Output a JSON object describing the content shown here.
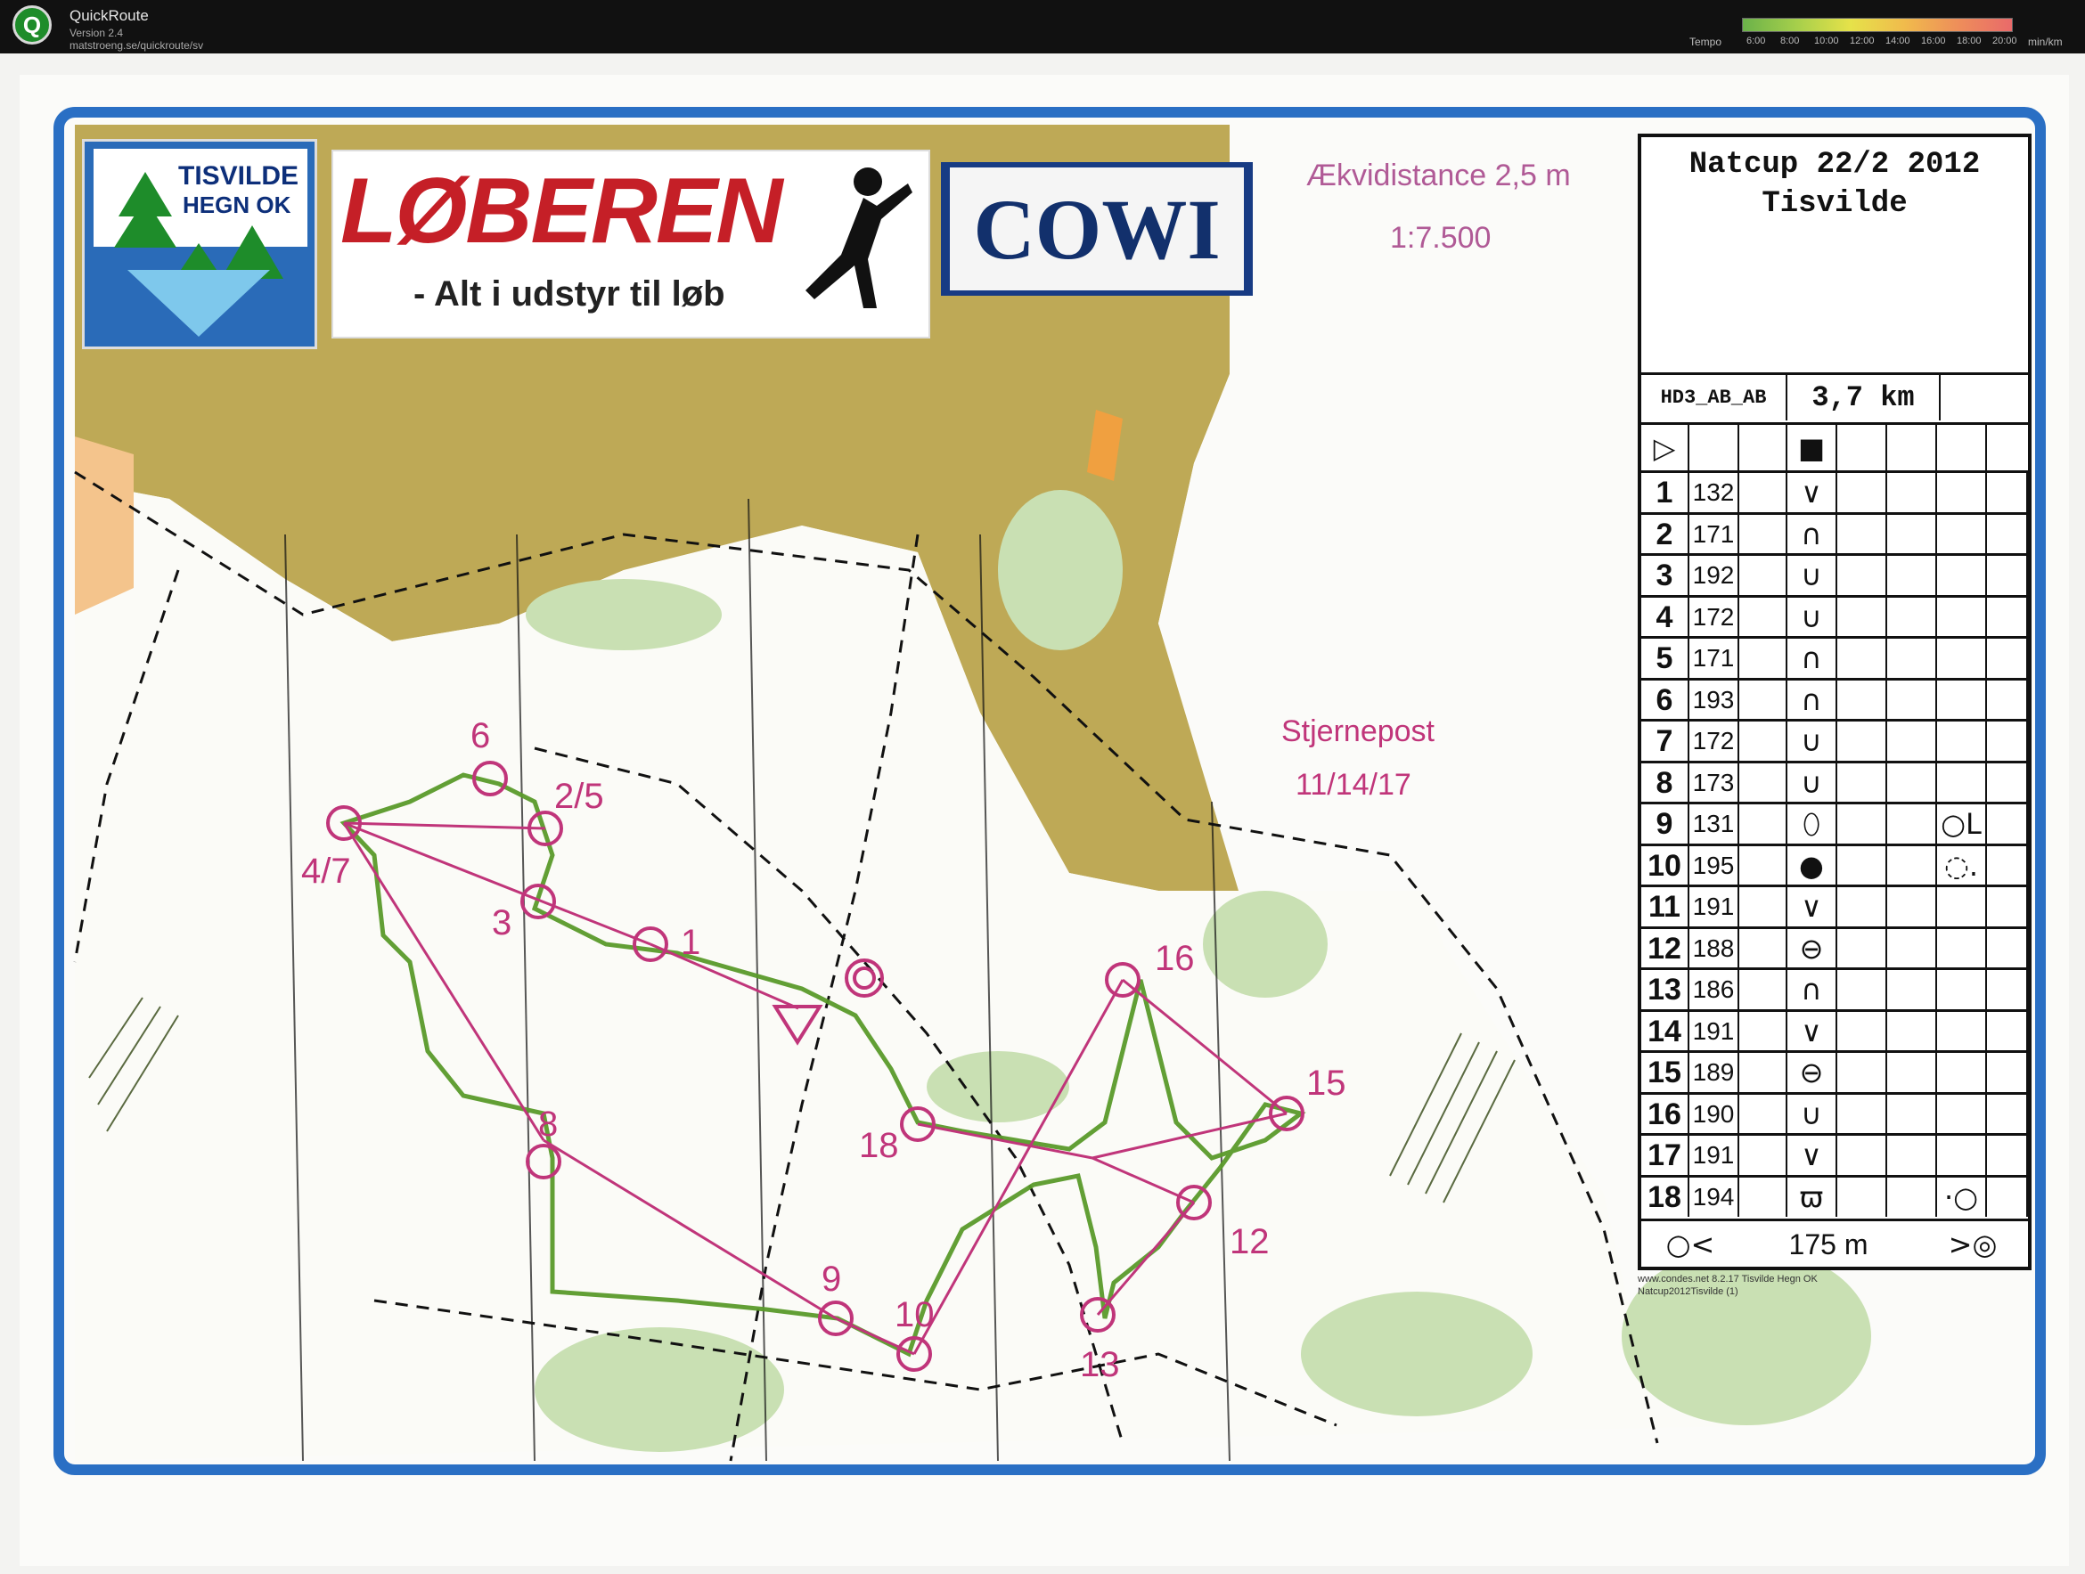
{
  "app": {
    "title": "QuickRoute",
    "version": "Version 2.4",
    "url": "matstroeng.se/quickroute/sv",
    "logo_letter": "Q"
  },
  "tempo": {
    "label": "Tempo",
    "ticks": [
      "6:00",
      "8:00",
      "10:00",
      "12:00",
      "14:00",
      "16:00",
      "18:00",
      "20:00"
    ],
    "unit": "min/km"
  },
  "map": {
    "club_name_1": "TISVILDE",
    "club_name_2": "HEGN OK",
    "sponsor_1": "LØBEREN",
    "sponsor_1_sub": "- Alt i udstyr til løb",
    "sponsor_2": "COWI",
    "equidistance": "Ækvidistance 2,5 m",
    "scale": "1:7.500",
    "star_post_label": "Stjernepost",
    "star_post_values": "11/14/17",
    "control_labels": [
      {
        "text": "6"
      },
      {
        "text": "2/5"
      },
      {
        "text": "4/7"
      },
      {
        "text": "3"
      },
      {
        "text": "1"
      },
      {
        "text": "16"
      },
      {
        "text": "15"
      },
      {
        "text": "18"
      },
      {
        "text": "8"
      },
      {
        "text": "12"
      },
      {
        "text": "9"
      },
      {
        "text": "10"
      },
      {
        "text": "13"
      }
    ],
    "colors": {
      "frame": "#2a6fc4",
      "course": "#c0357a",
      "route": "#5a9a2a",
      "settlement": "#b39a3a",
      "forest": "#c9e0b3"
    }
  },
  "control_description": {
    "title_1": "Natcup 22/2 2012",
    "title_2": "Tisvilde",
    "course_code": "HD3_AB_AB",
    "length": "3,7 km",
    "start_symbol": "▷",
    "start_feature": "■",
    "rows": [
      {
        "num": "1",
        "code": "132",
        "sym": "∨",
        "extra": ""
      },
      {
        "num": "2",
        "code": "171",
        "sym": "∩",
        "extra": ""
      },
      {
        "num": "3",
        "code": "192",
        "sym": "∪",
        "extra": ""
      },
      {
        "num": "4",
        "code": "172",
        "sym": "∪",
        "extra": ""
      },
      {
        "num": "5",
        "code": "171",
        "sym": "∩",
        "extra": ""
      },
      {
        "num": "6",
        "code": "193",
        "sym": "∩",
        "extra": ""
      },
      {
        "num": "7",
        "code": "172",
        "sym": "∪",
        "extra": ""
      },
      {
        "num": "8",
        "code": "173",
        "sym": "∪",
        "extra": ""
      },
      {
        "num": "9",
        "code": "131",
        "sym": "⬯",
        "extra": "○L"
      },
      {
        "num": "10",
        "code": "195",
        "sym": "●",
        "extra": "◌."
      },
      {
        "num": "11",
        "code": "191",
        "sym": "∨",
        "extra": ""
      },
      {
        "num": "12",
        "code": "188",
        "sym": "⊖",
        "extra": ""
      },
      {
        "num": "13",
        "code": "186",
        "sym": "∩",
        "extra": ""
      },
      {
        "num": "14",
        "code": "191",
        "sym": "∨",
        "extra": ""
      },
      {
        "num": "15",
        "code": "189",
        "sym": "⊖",
        "extra": ""
      },
      {
        "num": "16",
        "code": "190",
        "sym": "∪",
        "extra": ""
      },
      {
        "num": "17",
        "code": "191",
        "sym": "∨",
        "extra": ""
      },
      {
        "num": "18",
        "code": "194",
        "sym": "ϖ",
        "extra": "·○"
      }
    ],
    "finish_left": "○<",
    "finish_distance": "175 m",
    "finish_right": ">◎",
    "credit_1": "www.condes.net 8.2.17 Tisvilde Hegn OK",
    "credit_2": "Natcup2012Tisvilde (1)"
  }
}
